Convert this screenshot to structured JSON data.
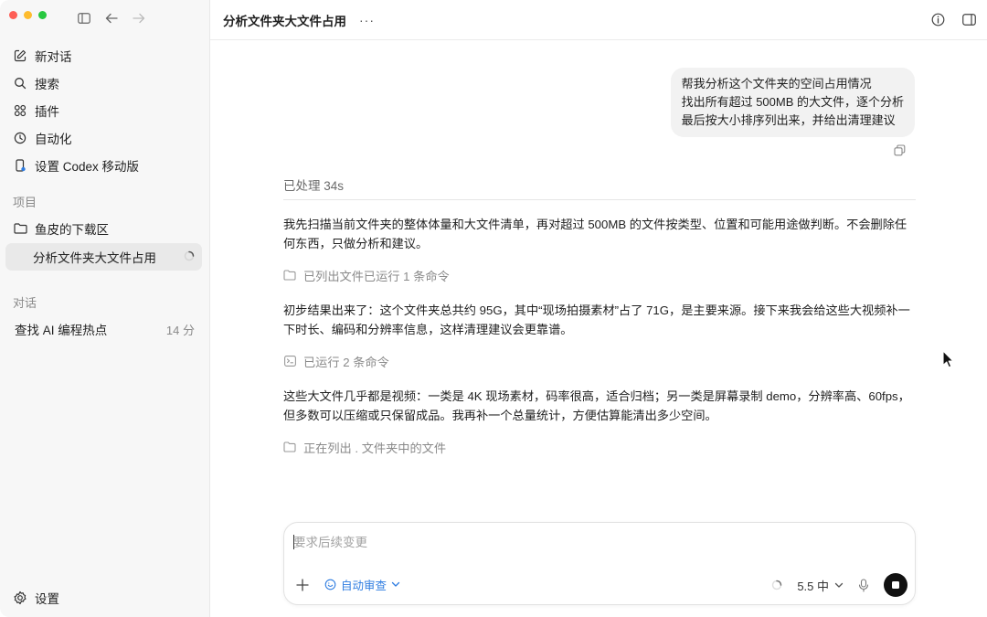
{
  "sidebar": {
    "nav": [
      {
        "label": "新对话",
        "icon": "edit-icon"
      },
      {
        "label": "搜索",
        "icon": "search-icon"
      },
      {
        "label": "插件",
        "icon": "plugins-icon"
      },
      {
        "label": "自动化",
        "icon": "clock-icon"
      },
      {
        "label": "设置 Codex 移动版",
        "icon": "phone-icon"
      }
    ],
    "projects_label": "项目",
    "projects": [
      {
        "label": "鱼皮的下载区",
        "icon": "folder-icon"
      },
      {
        "label": "分析文件夹大文件占用",
        "active": true,
        "status": "loading-spinner-icon"
      }
    ],
    "conversations_label": "对话",
    "conversations": [
      {
        "label": "查找 AI 编程热点",
        "time": "14 分"
      }
    ],
    "settings_label": "设置"
  },
  "topbar": {
    "title": "分析文件夹大文件占用",
    "more": "···"
  },
  "chat": {
    "user_message": [
      "帮我分析这个文件夹的空间占用情况",
      "找出所有超过 500MB 的大文件，逐个分析",
      "最后按大小排序列出来，并给出清理建议"
    ],
    "processed": "已处理 34s",
    "para1": "我先扫描当前文件夹的整体体量和大文件清单，再对超过 500MB 的文件按类型、位置和可能用途做判断。不会删除任何东西，只做分析和建议。",
    "step1": "已列出文件已运行 1 条命令",
    "para2": "初步结果出来了：这个文件夹总共约 95G，其中“现场拍摄素材”占了 71G，是主要来源。接下来我会给这些大视频补一下时长、编码和分辨率信息，这样清理建议会更靠谱。",
    "step2": "已运行 2 条命令",
    "para3": "这些大文件几乎都是视频：一类是 4K 现场素材，码率很高，适合归档；另一类是屏幕录制 demo，分辨率高、60fps，但多数可以压缩或只保留成品。我再补一个总量统计，方便估算能清出多少空间。",
    "step3": "正在列出 . 文件夹中的文件"
  },
  "composer": {
    "placeholder": "要求后续变更",
    "value": "",
    "review_label": "自动审查",
    "model_label": "5.5 中"
  },
  "colors": {
    "accent": "#2f7de1",
    "sidebar_bg": "#f7f7f7",
    "bubble_bg": "#f2f2f2"
  }
}
